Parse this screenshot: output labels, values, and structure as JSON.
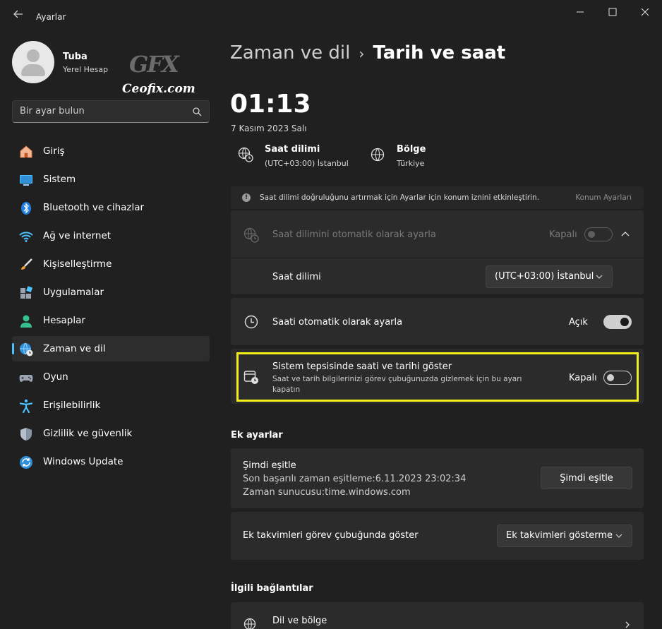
{
  "window": {
    "title": "Ayarlar",
    "controls": {
      "minimize": "—",
      "maximize": "☐",
      "close": "✕"
    }
  },
  "watermark": {
    "logo": "GFX",
    "site": "Ceofix.com"
  },
  "user": {
    "name": "Tuba",
    "account_type": "Yerel Hesap"
  },
  "search": {
    "placeholder": "Bir ayar bulun"
  },
  "sidebar": {
    "items": [
      {
        "label": "Giriş",
        "icon": "home-icon"
      },
      {
        "label": "Sistem",
        "icon": "monitor-icon"
      },
      {
        "label": "Bluetooth ve cihazlar",
        "icon": "bluetooth-icon"
      },
      {
        "label": "Ağ ve internet",
        "icon": "wifi-icon"
      },
      {
        "label": "Kişiselleştirme",
        "icon": "brush-icon"
      },
      {
        "label": "Uygulamalar",
        "icon": "apps-icon"
      },
      {
        "label": "Hesaplar",
        "icon": "person-icon"
      },
      {
        "label": "Zaman ve dil",
        "icon": "globe-clock-icon",
        "active": true
      },
      {
        "label": "Oyun",
        "icon": "gamepad-icon"
      },
      {
        "label": "Erişilebilirlik",
        "icon": "accessibility-icon"
      },
      {
        "label": "Gizlilik ve güvenlik",
        "icon": "shield-icon"
      },
      {
        "label": "Windows Update",
        "icon": "update-icon"
      }
    ]
  },
  "breadcrumb": {
    "parent": "Zaman ve dil",
    "separator": "›",
    "current": "Tarih ve saat"
  },
  "clock": {
    "time": "01:13",
    "date": "7 Kasım 2023 Salı"
  },
  "timezone_info": {
    "title": "Saat dilimi",
    "value": "(UTC+03:00) İstanbul"
  },
  "region_info": {
    "title": "Bölge",
    "value": "Türkiye"
  },
  "banner": {
    "text": "Saat dilimi doğruluğunu artırmak için Ayarlar için konum iznini etkinleştirin.",
    "link": "Konum Ayarları"
  },
  "auto_timezone": {
    "title": "Saat dilimini otomatik olarak ayarla",
    "state": "Kapalı",
    "on": false,
    "disabled": true
  },
  "timezone_select": {
    "label": "Saat dilimi",
    "value": "(UTC+03:00) İstanbul"
  },
  "auto_time": {
    "title": "Saati otomatik olarak ayarla",
    "state": "Açık",
    "on": true
  },
  "tray_clock": {
    "title": "Sistem tepsisinde saati ve tarihi göster",
    "description": "Saat ve tarih bilgilerinizi görev çubuğunuzda gizlemek için bu ayarı kapatın",
    "state": "Kapalı",
    "on": false,
    "highlight_color": "#f2ef1a"
  },
  "additional": {
    "heading": "Ek ayarlar",
    "sync": {
      "title": "Şimdi eşitle",
      "last_sync": "Son başarılı zaman eşitleme:6.11.2023 23:02:34",
      "server": "Zaman sunucusu:time.windows.com",
      "button": "Şimdi eşitle"
    },
    "calendars": {
      "label": "Ek takvimleri görev çubuğunda göster",
      "value": "Ek takvimleri gösterme"
    }
  },
  "related": {
    "heading": "İlgili bağlantılar",
    "items": [
      {
        "label": "Dil ve bölge"
      }
    ]
  },
  "colors": {
    "background": "#202020",
    "card": "#2b2b2b",
    "accent": "#4cc2ff"
  }
}
